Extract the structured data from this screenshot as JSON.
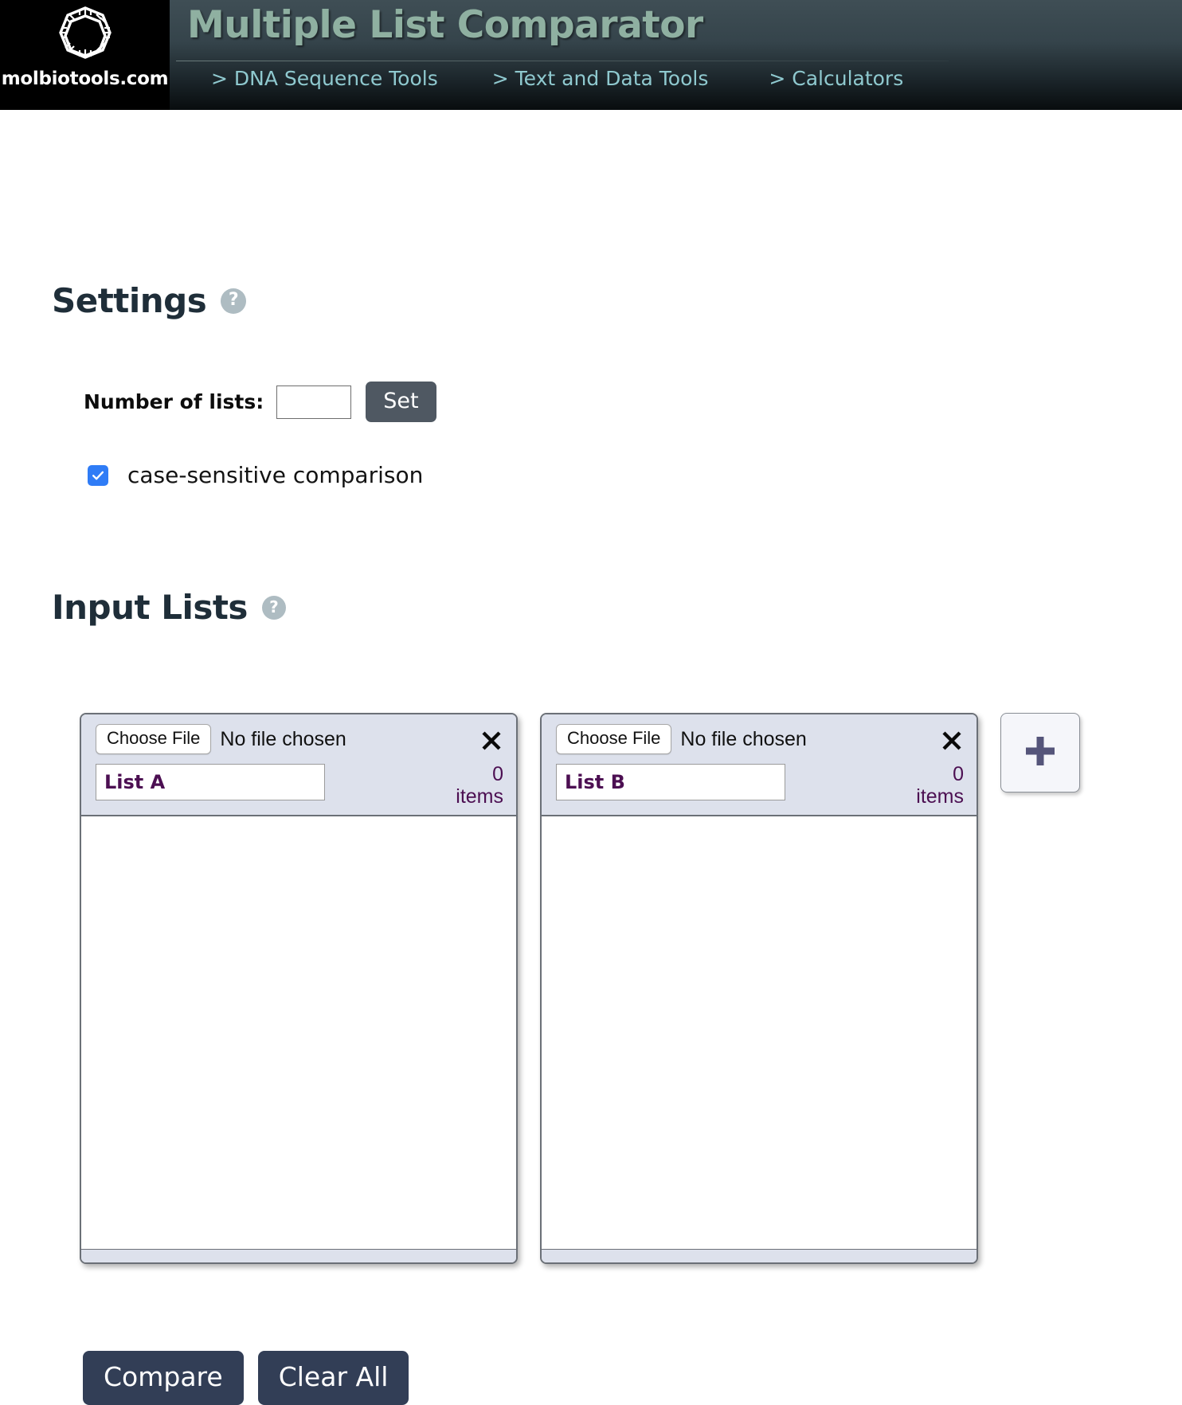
{
  "header": {
    "brand_name": "molbiotools.com",
    "logo_icon": "dna-ring-icon",
    "app_title": "Multiple List Comparator",
    "nav": [
      {
        "label": "> DNA Sequence Tools",
        "name": "nav-dna-sequence-tools"
      },
      {
        "label": "> Text and Data Tools",
        "name": "nav-text-and-data-tools"
      },
      {
        "label": "> Calculators",
        "name": "nav-calculators"
      }
    ]
  },
  "settings": {
    "title": "Settings",
    "help_glyph": "?",
    "number_of_lists_label": "Number of lists:",
    "number_of_lists_value": "",
    "number_of_lists_placeholder": "",
    "set_button_label": "Set",
    "case_sensitive_label": "case-sensitive comparison",
    "case_sensitive_checked": true,
    "checkbox_color": "#2f7cf6"
  },
  "input_lists": {
    "title": "Input Lists",
    "help_glyph": "?",
    "add_list_icon": "plus-icon",
    "cards": [
      {
        "choose_file_label": "Choose File",
        "file_status": "No file chosen",
        "close_icon": "close-icon",
        "list_name": "List A",
        "count_value": "0",
        "count_unit": "items",
        "content": ""
      },
      {
        "choose_file_label": "Choose File",
        "file_status": "No file chosen",
        "close_icon": "close-icon",
        "list_name": "List B",
        "count_value": "0",
        "count_unit": "items",
        "content": ""
      }
    ]
  },
  "actions": {
    "compare_label": "Compare",
    "clear_all_label": "Clear All"
  },
  "colors": {
    "header_accent": "#8fb0a1",
    "nav_link": "#8fc9cf",
    "button_navy": "#323e56",
    "button_gray": "#4f5862",
    "list_purple": "#4c0f52",
    "card_head": "#dde1ec"
  }
}
